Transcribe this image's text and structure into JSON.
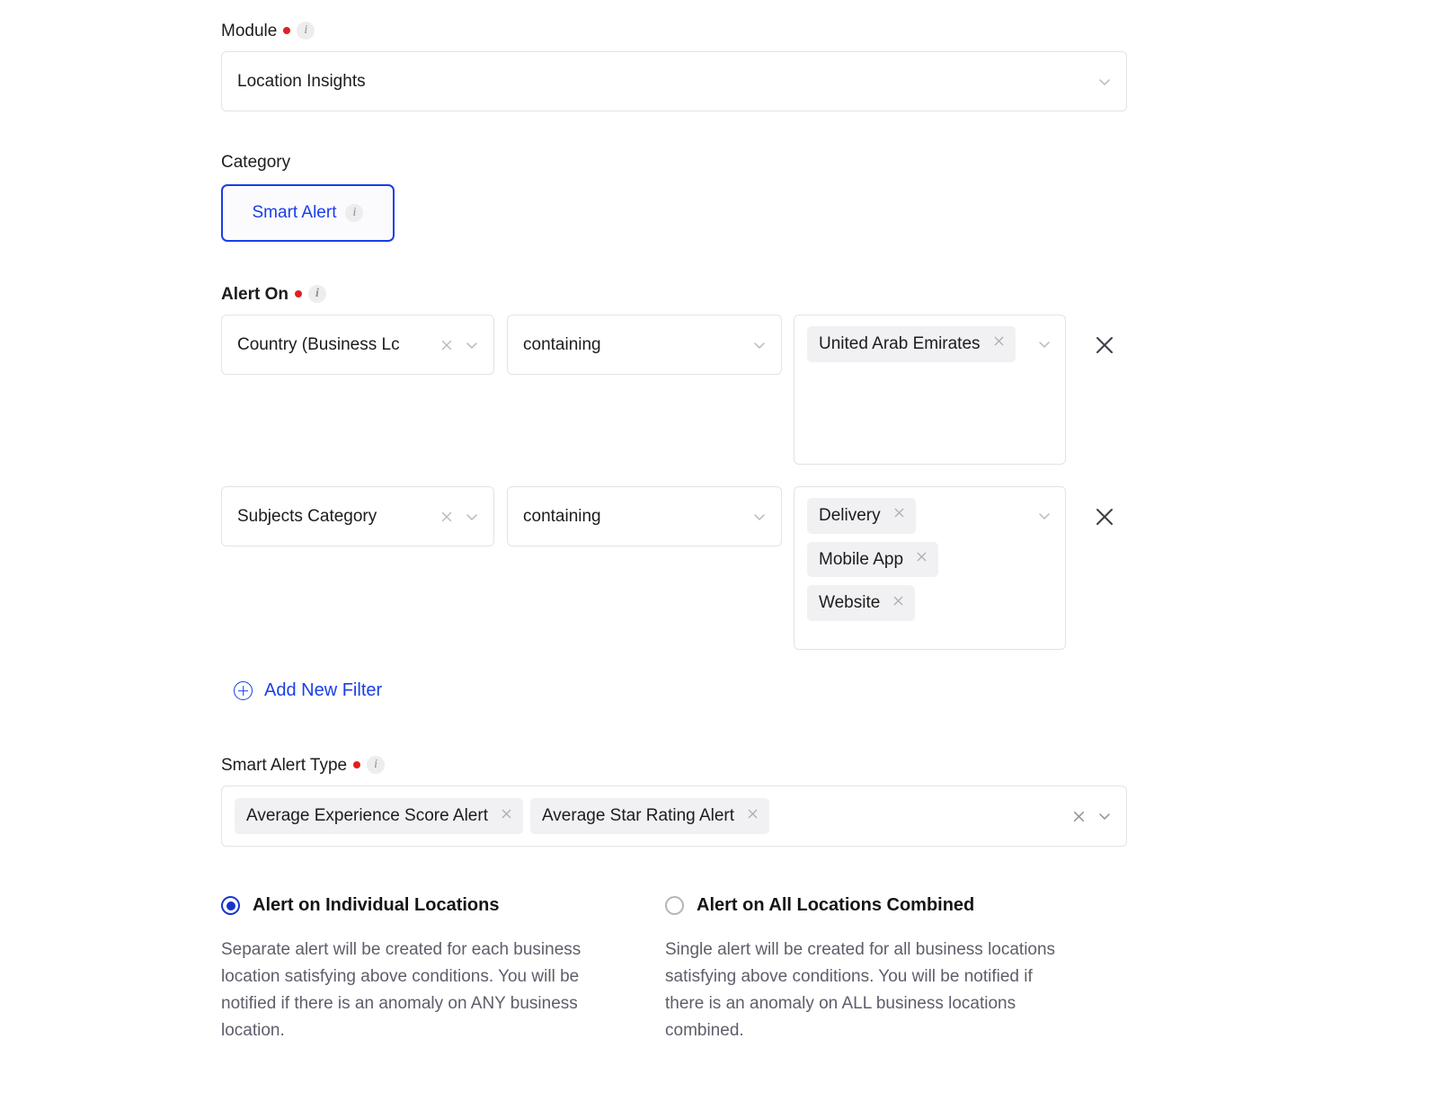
{
  "module": {
    "label": "Module",
    "required": true,
    "info_icon": "info-icon",
    "value": "Location Insights",
    "chevron_icon": "chevron-down-icon"
  },
  "category": {
    "label": "Category",
    "selected_chip": "Smart Alert",
    "info_icon": "info-icon",
    "accent_color": "#1a3ee8"
  },
  "alert_on": {
    "label": "Alert On",
    "required": true,
    "info_icon": "info-icon",
    "filters": [
      {
        "subject": "Country (Business Lc",
        "subject_clear_icon": "close-icon",
        "subject_chevron_icon": "chevron-down-icon",
        "operator": "containing",
        "operator_chevron_icon": "chevron-down-icon",
        "values": [
          "United Arab Emirates"
        ],
        "values_chevron_icon": "chevron-down-icon",
        "tag_remove_icon": "close-icon",
        "delete_row_icon": "close-icon"
      },
      {
        "subject": "Subjects Category",
        "subject_clear_icon": "close-icon",
        "subject_chevron_icon": "chevron-down-icon",
        "operator": "containing",
        "operator_chevron_icon": "chevron-down-icon",
        "values": [
          "Delivery",
          "Mobile App",
          "Website"
        ],
        "values_chevron_icon": "chevron-down-icon",
        "tag_remove_icon": "close-icon",
        "delete_row_icon": "close-icon"
      }
    ],
    "add_filter_label": "Add New Filter",
    "add_filter_icon": "plus-circle-icon"
  },
  "smart_alert_type": {
    "label": "Smart Alert Type",
    "required": true,
    "info_icon": "info-icon",
    "tags": [
      "Average Experience Score Alert",
      "Average Star Rating Alert"
    ],
    "tag_remove_icon": "close-icon",
    "clear_all_icon": "close-icon",
    "chevron_icon": "chevron-down-icon"
  },
  "alert_scope": {
    "options": [
      {
        "title": "Alert on Individual Locations",
        "selected": true,
        "description": "Separate alert will be created for each business location satisfying above conditions. You will be notified if there is an anomaly on ANY business location."
      },
      {
        "title": "Alert on All Locations Combined",
        "selected": false,
        "description": "Single alert will be created for all business locations satisfying above conditions. You will be notified if there is an anomaly on ALL business locations combined."
      }
    ],
    "selected_color": "#1733cc"
  },
  "glyphs": {
    "chevron_down": "⌄",
    "close_small": "✕",
    "close_large": "✕"
  }
}
